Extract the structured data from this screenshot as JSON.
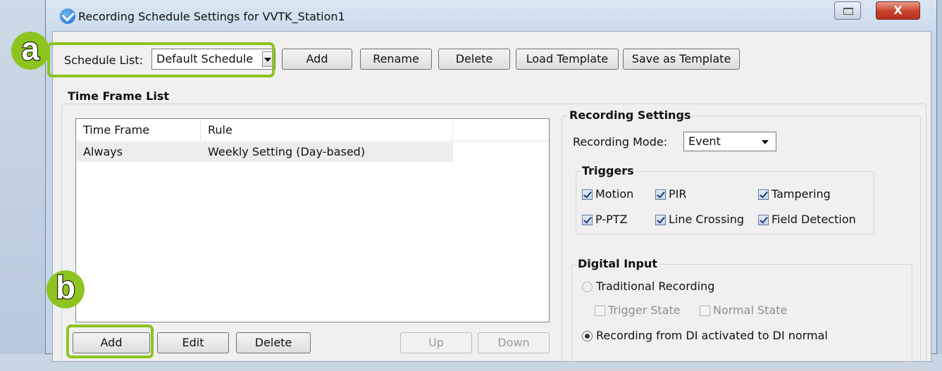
{
  "window": {
    "title": "Recording Schedule Settings for VVTK_Station1",
    "close_glyph": "X"
  },
  "toolbar": {
    "schedule_list_label": "Schedule List:",
    "schedule_value": "Default Schedule",
    "add": "Add",
    "rename": "Rename",
    "delete": "Delete",
    "load_template": "Load Template",
    "save_as_template": "Save as Template"
  },
  "time_frame_list": {
    "title": "Time Frame List",
    "columns": [
      "Time Frame",
      "Rule"
    ],
    "rows": [
      {
        "time_frame": "Always",
        "rule": "Weekly Setting (Day-based)"
      }
    ],
    "buttons": {
      "add": "Add",
      "edit": "Edit",
      "delete": "Delete",
      "up": "Up",
      "down": "Down"
    }
  },
  "recording_settings": {
    "title": "Recording Settings",
    "mode_label": "Recording Mode:",
    "mode_value": "Event",
    "triggers": {
      "title": "Triggers",
      "items": [
        {
          "label": "Motion",
          "checked": true
        },
        {
          "label": "PIR",
          "checked": true
        },
        {
          "label": "Tampering",
          "checked": true
        },
        {
          "label": "P-PTZ",
          "checked": true
        },
        {
          "label": "Line Crossing",
          "checked": true
        },
        {
          "label": "Field Detection",
          "checked": true
        }
      ]
    },
    "digital_input": {
      "title": "Digital Input",
      "traditional": "Traditional Recording",
      "trigger_state": "Trigger State",
      "normal_state": "Normal State",
      "di_activated": "Recording from DI activated to DI normal"
    }
  },
  "callouts": {
    "a": "a",
    "b": "b"
  },
  "colors": {
    "callout_green": "#8dc41f",
    "title_close_red": "#c8412a"
  }
}
